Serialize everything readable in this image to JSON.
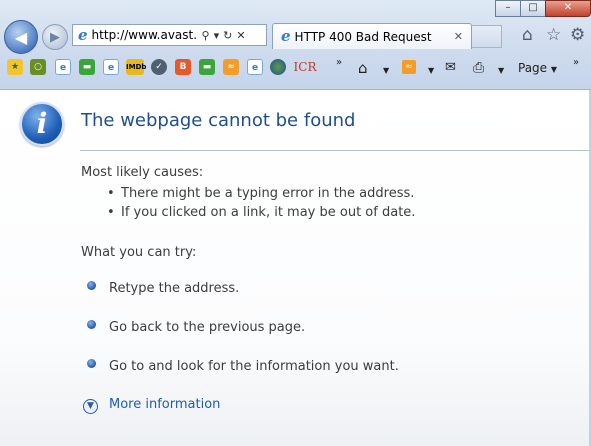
{
  "browser": {
    "address_text": "http://www.avast...",
    "tab_title": "HTTP 400 Bad Request",
    "favorites": {
      "imdb_label": "IMDb",
      "icr_label": "ICR"
    },
    "command_bar": {
      "page_label": "Page"
    },
    "window_controls": {
      "minimize": "–",
      "maximize": "□",
      "close": "✕"
    }
  },
  "page": {
    "title": "The webpage cannot be found",
    "causes_heading": "Most likely causes:",
    "causes": [
      "There might be a typing error in the address.",
      "If you clicked on a link, it may be out of date."
    ],
    "try_heading": "What you can try:",
    "try_items": [
      "Retype the address.",
      "Go back to the previous page.",
      "Go to  and look for the information you want."
    ],
    "more_info": "More information"
  },
  "colors": {
    "title_blue": "#1f4e91",
    "link_blue": "#1f5db0",
    "body_text": "#3c3c3c"
  },
  "icons": [
    "back-arrow-icon",
    "forward-arrow-icon",
    "ie-logo-icon",
    "search-icon",
    "refresh-icon",
    "stop-icon",
    "home-icon",
    "favorites-star-icon",
    "tools-gear-icon",
    "rss-feed-icon",
    "mail-icon",
    "print-icon",
    "information-icon",
    "expand-down-icon"
  ]
}
